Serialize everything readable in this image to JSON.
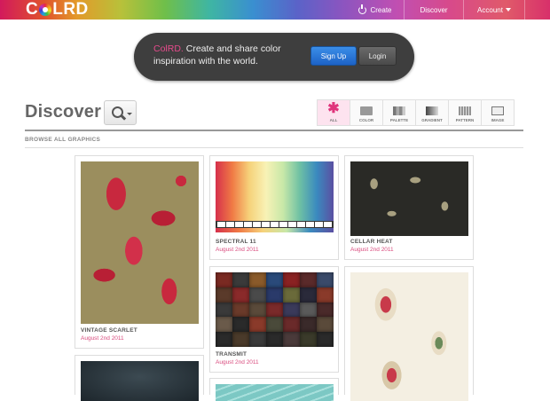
{
  "topbar": {
    "logo": {
      "left": "C",
      "right": "LRD"
    },
    "nav": [
      {
        "label": "Create",
        "icon": "power-icon"
      },
      {
        "label": "Discover"
      },
      {
        "label": "Account",
        "icon": "caret-down-icon"
      }
    ]
  },
  "hero": {
    "brand": "ColRD.",
    "text": "Create and share color inspiration with the world.",
    "signup_label": "Sign Up",
    "login_label": "Login"
  },
  "discover": {
    "title": "Discover",
    "browse_label": "BROWSE ALL GRAPHICS",
    "filters": [
      {
        "label": "ALL",
        "icon": "star-icon",
        "active": true
      },
      {
        "label": "COLOR",
        "icon": "color-icon"
      },
      {
        "label": "PALETTE",
        "icon": "palette-icon"
      },
      {
        "label": "GRADIENT",
        "icon": "gradient-icon"
      },
      {
        "label": "PATTERN",
        "icon": "pattern-icon"
      },
      {
        "label": "IMAGE",
        "icon": "image-icon"
      }
    ]
  },
  "cards": [
    {
      "title": "VINTAGE SCARLET",
      "date": "August 2nd 2011"
    },
    {
      "title": "SPECTRAL 11",
      "date": "August 2nd 2011"
    },
    {
      "title": "CELLAR HEAT",
      "date": "August 2nd 2011"
    },
    {
      "title": "TRANSMIT",
      "date": "August 2nd 2011"
    }
  ],
  "colors": {
    "brand_pink": "#d94b7e",
    "signup_blue": "#1d62c6",
    "hero_bg": "#3e3e3e"
  }
}
